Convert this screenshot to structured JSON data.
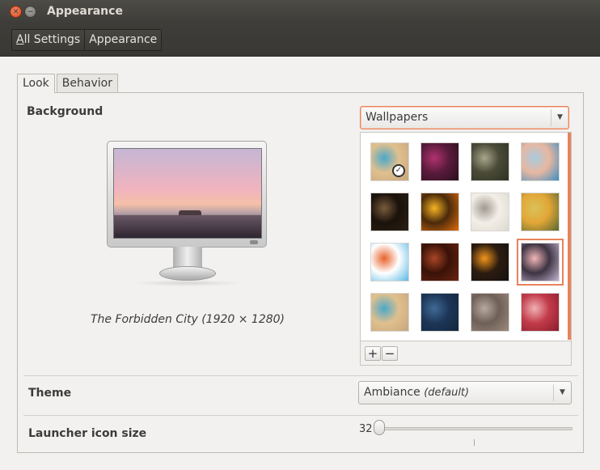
{
  "window": {
    "title": "Appearance"
  },
  "breadcrumb": {
    "all_settings_underlined": "A",
    "all_settings_rest": "ll Settings",
    "current": "Appearance"
  },
  "tabs": [
    {
      "label": "Look",
      "active": true
    },
    {
      "label": "Behavior",
      "active": false
    }
  ],
  "background": {
    "label": "Background",
    "source_select": "Wallpapers",
    "preview_caption": "The Forbidden City (1920 × 1280)",
    "wallpapers": [
      {
        "name": "wallpaper-1",
        "colors": [
          "#c7a57e",
          "#4aa8c9",
          "#e0c08e"
        ],
        "selected": false,
        "badge": "clock-icon"
      },
      {
        "name": "wallpaper-2",
        "colors": [
          "#2a0f1c",
          "#b13370",
          "#5a1b3c"
        ],
        "selected": false
      },
      {
        "name": "wallpaper-3",
        "colors": [
          "#2e3322",
          "#a8a68b",
          "#4a4a38"
        ],
        "selected": false
      },
      {
        "name": "wallpaper-4",
        "colors": [
          "#3b8fc4",
          "#a9cbe0",
          "#e8b7a0"
        ],
        "selected": false
      },
      {
        "name": "wallpaper-5",
        "colors": [
          "#2d2016",
          "#7a5b3c",
          "#1a120b"
        ],
        "selected": false
      },
      {
        "name": "wallpaper-6",
        "colors": [
          "#e06c0d",
          "#f7b322",
          "#4a2a0b"
        ],
        "selected": false
      },
      {
        "name": "wallpaper-7",
        "colors": [
          "#ddd8cf",
          "#9f998e",
          "#f3efe8"
        ],
        "selected": false
      },
      {
        "name": "wallpaper-8",
        "colors": [
          "#586831",
          "#d9c25a",
          "#e2a636"
        ],
        "selected": false
      },
      {
        "name": "wallpaper-9",
        "colors": [
          "#5bb8e3",
          "#e8622a",
          "#ffffff"
        ],
        "selected": false
      },
      {
        "name": "wallpaper-10",
        "colors": [
          "#6a2412",
          "#a84527",
          "#3a1207"
        ],
        "selected": false
      },
      {
        "name": "wallpaper-11",
        "colors": [
          "#141011",
          "#f2951a",
          "#2c1c10"
        ],
        "selected": false
      },
      {
        "name": "wallpaper-12",
        "colors": [
          "#c4b3d2",
          "#f2b6b8",
          "#3d3442"
        ],
        "selected": true
      },
      {
        "name": "wallpaper-13",
        "colors": [
          "#c7a57e",
          "#4aa8c9",
          "#e0c08e"
        ],
        "selected": false
      },
      {
        "name": "wallpaper-14",
        "colors": [
          "#13263f",
          "#3f6a96",
          "#1d3657"
        ],
        "selected": false
      },
      {
        "name": "wallpaper-15",
        "colors": [
          "#9d8a7c",
          "#b8a9a0",
          "#6e6058"
        ],
        "selected": false
      },
      {
        "name": "wallpaper-16",
        "colors": [
          "#8b1c2e",
          "#f0b0b4",
          "#c23b4a"
        ],
        "selected": false
      }
    ],
    "add_button": "+",
    "remove_button": "−"
  },
  "theme": {
    "label": "Theme",
    "value": "Ambiance",
    "value_note": "(default)"
  },
  "launcher": {
    "label": "Launcher icon size",
    "value": "32"
  },
  "icons": {
    "close": "close-icon",
    "minimize": "minimize-icon",
    "dropdown": "chevron-down-icon"
  }
}
